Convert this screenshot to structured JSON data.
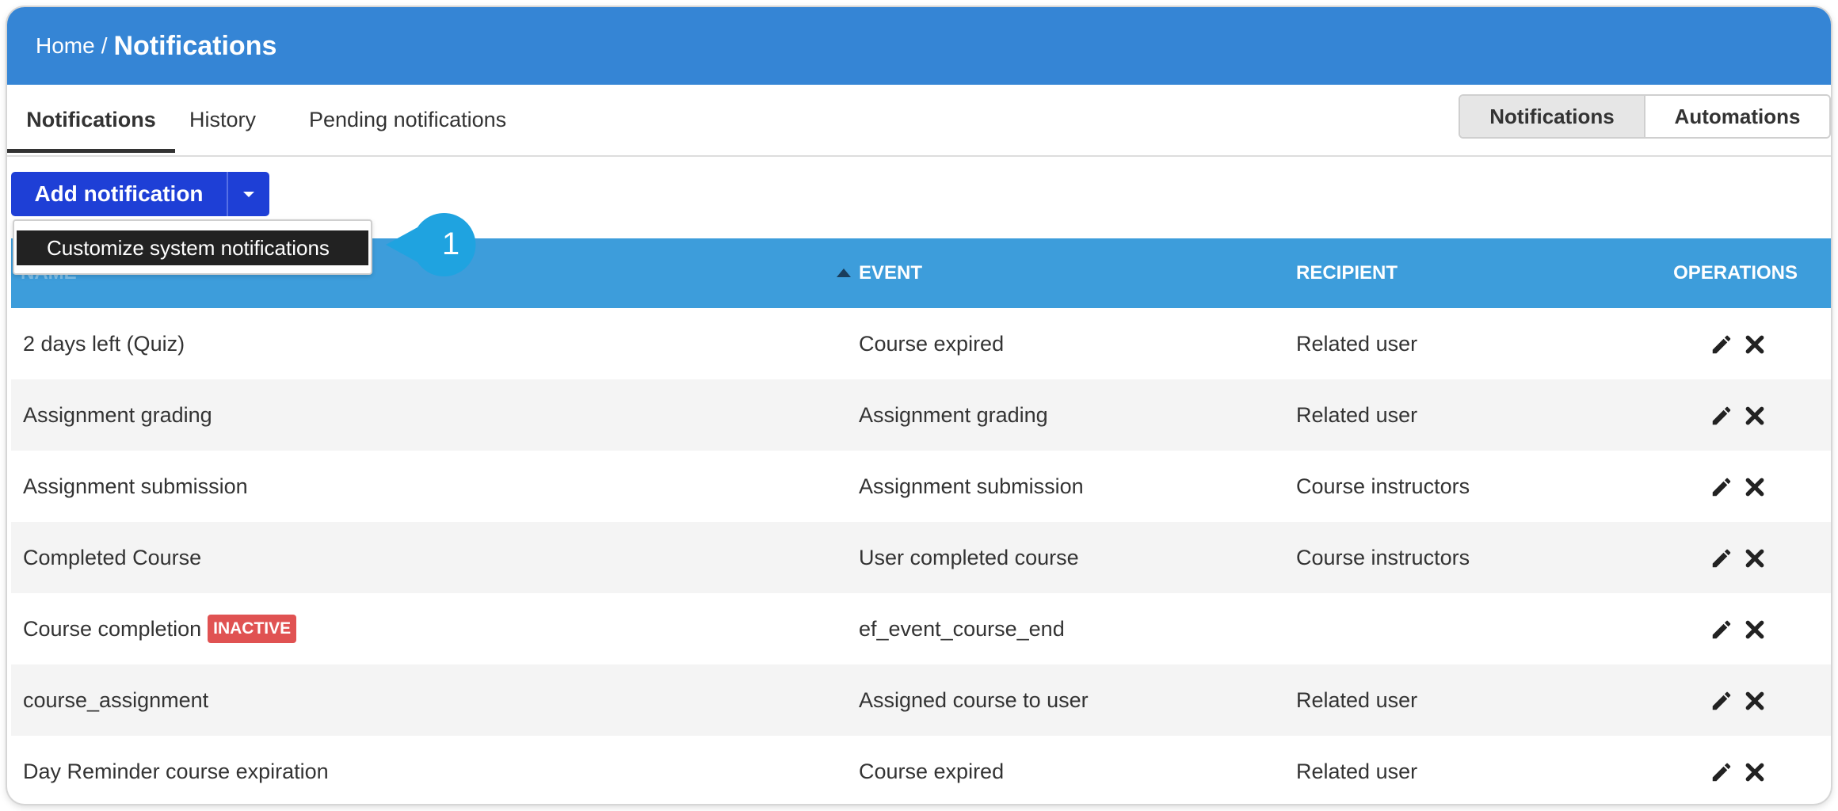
{
  "breadcrumb": {
    "home": "Home",
    "separator": "/",
    "current": "Notifications"
  },
  "tabs": [
    {
      "label": "Notifications",
      "active": true
    },
    {
      "label": "History",
      "active": false
    },
    {
      "label": "Pending notifications",
      "active": false
    }
  ],
  "view_toggle": {
    "notifications": "Notifications",
    "automations": "Automations",
    "selected": "Notifications"
  },
  "add_button": {
    "label": "Add notification",
    "caret_icon": "caret-down-icon"
  },
  "dropdown": {
    "item": "Customize system notifications"
  },
  "callout": {
    "number": "1",
    "color": "#1fa3e0"
  },
  "table": {
    "headers": {
      "name": "NAME",
      "event": "EVENT",
      "recipient": "RECIPIENT",
      "operations": "OPERATIONS"
    },
    "sort_icon": "sort-asc-icon",
    "rows": [
      {
        "name": "2 days left (Quiz)",
        "badge": "",
        "event": "Course expired",
        "recipient": "Related user"
      },
      {
        "name": "Assignment grading",
        "badge": "",
        "event": "Assignment grading",
        "recipient": "Related user"
      },
      {
        "name": "Assignment submission",
        "badge": "",
        "event": "Assignment submission",
        "recipient": "Course instructors"
      },
      {
        "name": "Completed Course",
        "badge": "",
        "event": "User completed course",
        "recipient": "Course instructors"
      },
      {
        "name": "Course completion",
        "badge": "INACTIVE",
        "event": "ef_event_course_end",
        "recipient": ""
      },
      {
        "name": "course_assignment",
        "badge": "",
        "event": "Assigned course to user",
        "recipient": "Related user"
      },
      {
        "name": "Day Reminder course expiration",
        "badge": "",
        "event": "Course expired",
        "recipient": "Related user"
      }
    ]
  },
  "colors": {
    "header_bg": "#3585d5",
    "table_header_bg": "#3d9ddb",
    "primary_button": "#1e3fd6",
    "badge_inactive": "#e05252"
  },
  "icons": {
    "edit": "pencil-icon",
    "delete": "close-icon"
  }
}
